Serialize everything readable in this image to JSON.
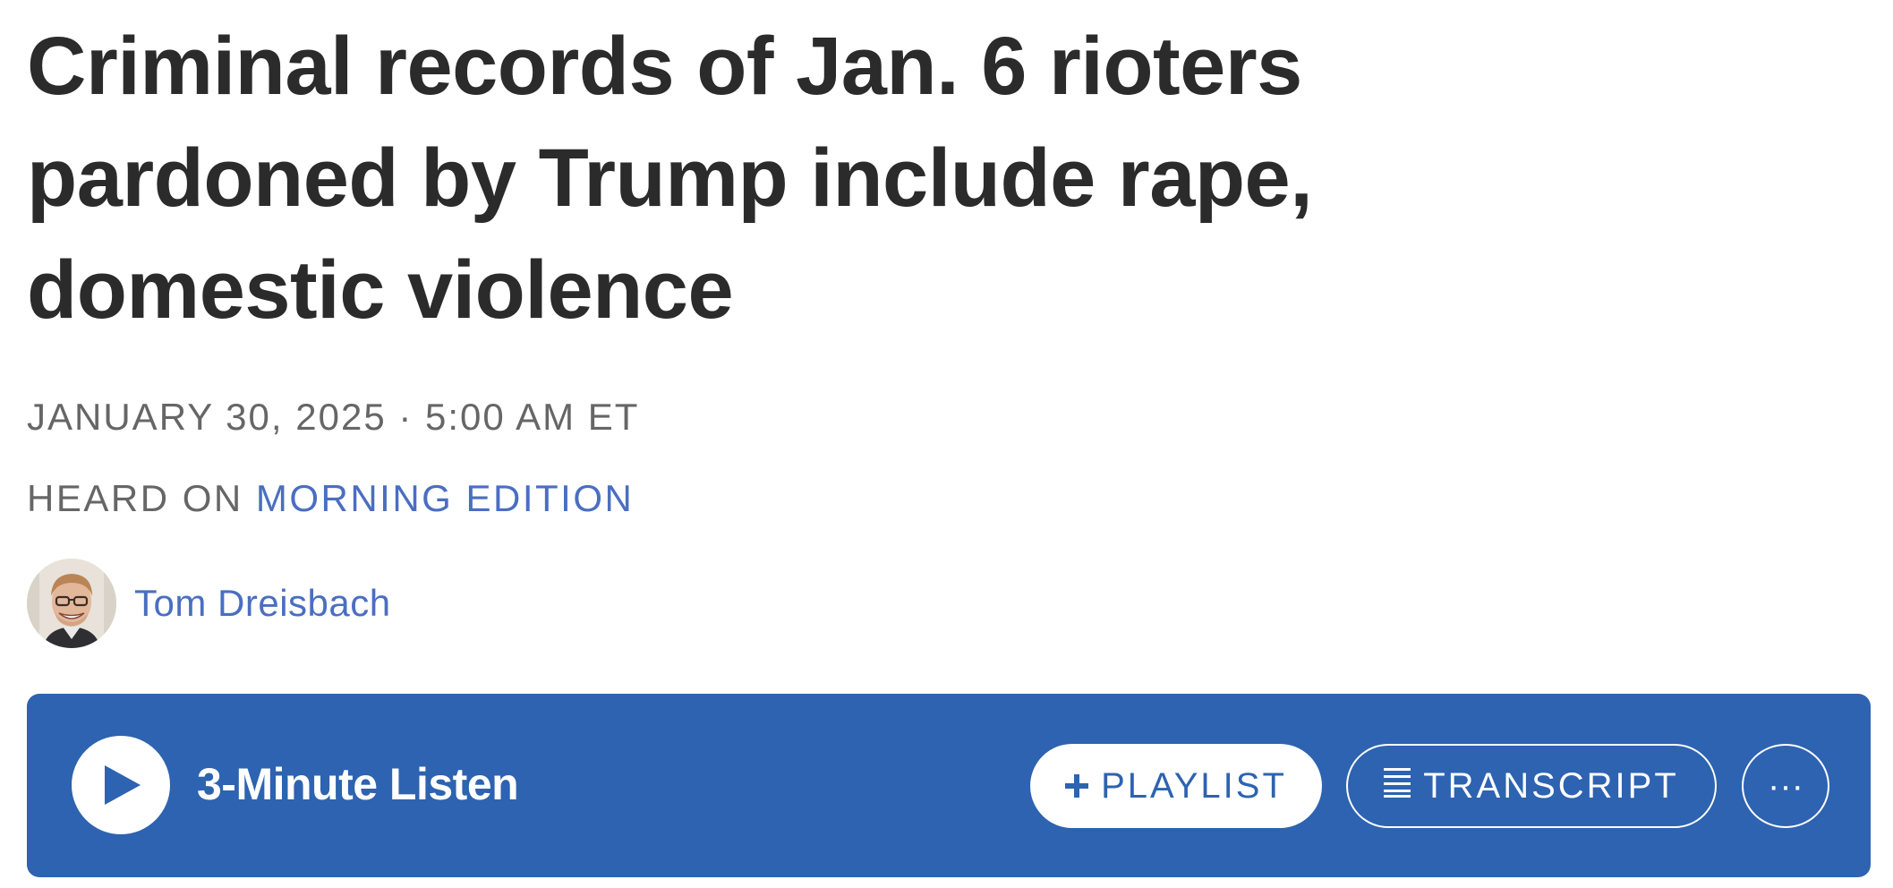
{
  "article": {
    "headline": "Criminal records of Jan. 6 rioters pardoned by Trump include rape, domestic violence",
    "dateline": "JANUARY 30, 2025 · 5:00 AM ET",
    "heard_on_prefix": "HEARD ON ",
    "program_name": "MORNING EDITION",
    "author": "Tom Dreisbach"
  },
  "player": {
    "listen_label": "3-Minute Listen",
    "playlist_label": "PLAYLIST",
    "transcript_label": "TRANSCRIPT",
    "more_label": "···",
    "bar_color": "#2d63b0"
  },
  "icons": {
    "play": "play-icon",
    "playlist_add": "plus-icon",
    "transcript": "transcript-lines-icon",
    "more": "ellipsis-icon"
  },
  "colors": {
    "headline": "#2b2b2b",
    "meta_text": "#666666",
    "link": "#4a6ec2",
    "player_bg": "#2d63b0"
  }
}
